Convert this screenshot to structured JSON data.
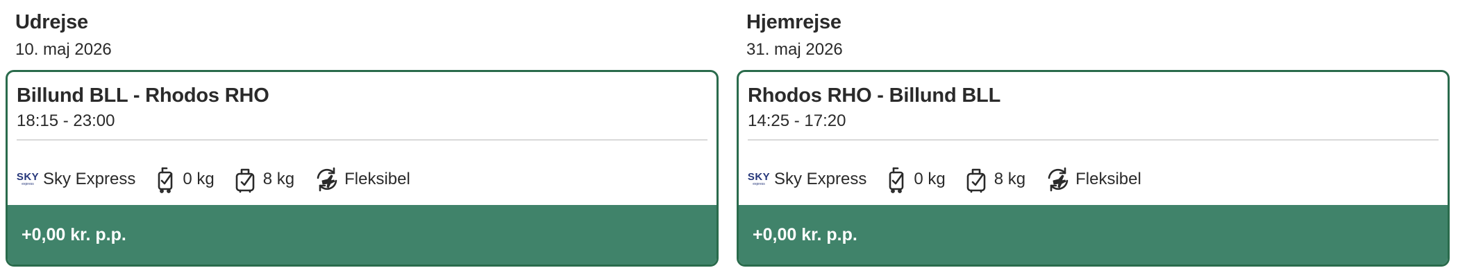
{
  "outbound": {
    "heading": "Udrejse",
    "date": "10. maj 2026",
    "route": "Billund BLL - Rhodos RHO",
    "times": "18:15 - 23:00",
    "airline_logo_text": "SKY",
    "airline_logo_subtext": "express",
    "airline": "Sky Express",
    "carry_on": "0 kg",
    "checked": "8 kg",
    "flex": "Fleksibel",
    "price": "+0,00 kr. p.p."
  },
  "return": {
    "heading": "Hjemrejse",
    "date": "31. maj 2026",
    "route": "Rhodos RHO - Billund BLL",
    "times": "14:25 - 17:20",
    "airline_logo_text": "SKY",
    "airline_logo_subtext": "express",
    "airline": "Sky Express",
    "carry_on": "0 kg",
    "checked": "8 kg",
    "flex": "Fleksibel",
    "price": "+0,00 kr. p.p."
  },
  "colors": {
    "accent": "#2a6b4c",
    "price_bar": "#40836a",
    "text": "#2a2a2a",
    "airline_logo": "#26377a"
  },
  "icons": [
    "carry-on-bag-icon",
    "checked-bag-icon",
    "flexible-ticket-icon"
  ]
}
